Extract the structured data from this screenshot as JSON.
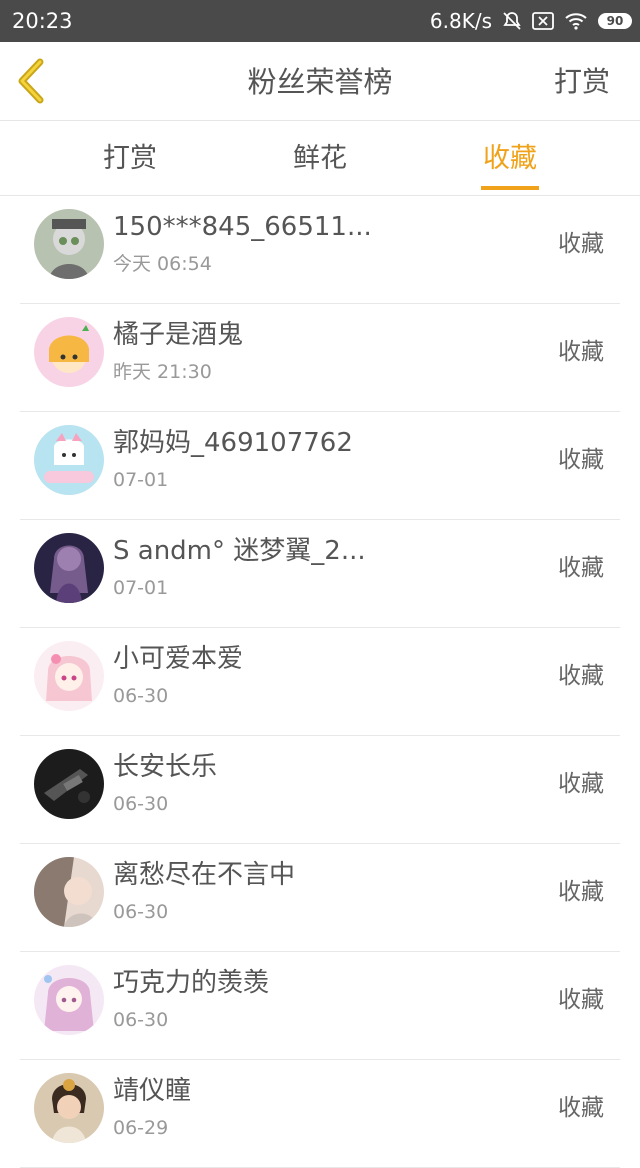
{
  "status_bar": {
    "time": "20:23",
    "net_speed": "6.8K/s",
    "battery": "90",
    "icons": [
      "bell-off-icon",
      "sim-off-icon",
      "wifi-icon",
      "battery-icon"
    ]
  },
  "header": {
    "title": "粉丝荣誉榜",
    "action": "打赏",
    "back_icon": "chevron-left-icon",
    "accent_color": "#f0a31a"
  },
  "tabs": [
    {
      "label": "打赏",
      "active": false
    },
    {
      "label": "鲜花",
      "active": false
    },
    {
      "label": "收藏",
      "active": true
    }
  ],
  "rows": [
    {
      "name": "150***845_66511...",
      "time": "今天 06:54",
      "action": "收藏"
    },
    {
      "name": "橘子是酒鬼",
      "time": "昨天 21:30",
      "action": "收藏"
    },
    {
      "name": "郭妈妈_469107762",
      "time": "07-01",
      "action": "收藏"
    },
    {
      "name": "S andm° 迷梦翼_2...",
      "time": "07-01",
      "action": "收藏"
    },
    {
      "name": "小可爱本爱",
      "time": "06-30",
      "action": "收藏"
    },
    {
      "name": "长安长乐",
      "time": "06-30",
      "action": "收藏"
    },
    {
      "name": "离愁尽在不言中",
      "time": "06-30",
      "action": "收藏"
    },
    {
      "name": "巧克力的羡羡",
      "time": "06-30",
      "action": "收藏"
    },
    {
      "name": "靖仪瞳",
      "time": "06-29",
      "action": "收藏"
    }
  ]
}
